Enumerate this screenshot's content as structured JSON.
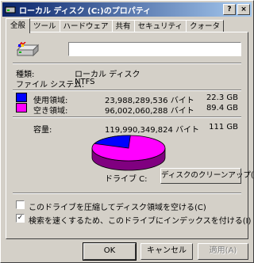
{
  "window": {
    "title": "ローカル ディスク (C:)のプロパティ",
    "help_label": "?",
    "close_label": "×"
  },
  "tabs": [
    {
      "label": "全般"
    },
    {
      "label": "ツール"
    },
    {
      "label": "ハードウェア"
    },
    {
      "label": "共有"
    },
    {
      "label": "セキュリティ"
    },
    {
      "label": "クォータ"
    }
  ],
  "general": {
    "name_value": "",
    "type_label": "種類:",
    "type_value": "ローカル ディスク",
    "fs_label": "ファイル システム:",
    "fs_value": "NTFS",
    "used": {
      "label": "使用領域:",
      "bytes": "23,988,289,536 バイト",
      "size": "22.3 GB",
      "color": "#0000ff"
    },
    "free": {
      "label": "空き領域:",
      "bytes": "96,002,060,288 バイト",
      "size": "89.4 GB",
      "color": "#ff00ff"
    },
    "capacity": {
      "label": "容量:",
      "bytes": "119,990,349,824 バイト",
      "size": "111 GB"
    },
    "drive_label": "ドライブ C:",
    "cleanup_button": "ディスクのクリーンアップ(D)",
    "used_fraction": 0.2
  },
  "options": {
    "compress": {
      "label": "このドライブを圧縮してディスク領域を空ける(C)",
      "checked": false
    },
    "index": {
      "label": "検索を速くするため、このドライブにインデックスを付ける(I)",
      "checked": true
    }
  },
  "buttons": {
    "ok": "OK",
    "cancel": "キャンセル",
    "apply": "適用(A)"
  },
  "icons": {
    "drive": "hard-drive-icon",
    "title": "drive-title-icon"
  }
}
